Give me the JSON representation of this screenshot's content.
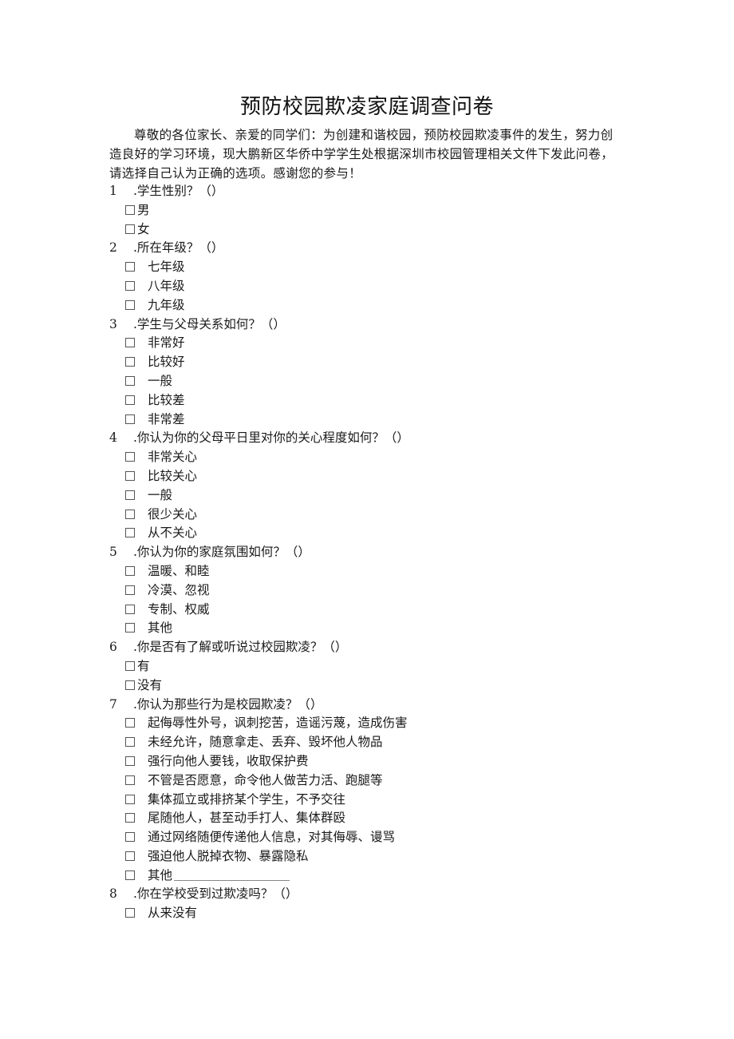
{
  "document": {
    "title": "预防校园欺凌家庭调查问卷",
    "intro": "尊敬的各位家长、亲爱的同学们：为创建和谐校园，预防校园欺凌事件的发生，努力创造良好的学习环境，现大鹏新区华侨中学学生处根据深圳市校园管理相关文件下发此问卷，请选择自己认为正确的选项。感谢您的参与！"
  },
  "questions": [
    {
      "num": "1",
      "text": ".学生性别？（）",
      "style": "tight",
      "options": [
        "男",
        "女"
      ]
    },
    {
      "num": "2",
      "text": ".所在年级？（）",
      "style": "spaced",
      "options": [
        "七年级",
        "八年级",
        "九年级"
      ]
    },
    {
      "num": "3",
      "text": ".学生与父母关系如何？（）",
      "style": "spaced",
      "options": [
        "非常好",
        "比较好",
        "一般",
        "比较差",
        "非常差"
      ]
    },
    {
      "num": "4",
      "text": ".你认为你的父母平日里对你的关心程度如何？（）",
      "style": "spaced",
      "options": [
        "非常关心",
        "比较关心",
        "一般",
        "很少关心",
        "从不关心"
      ]
    },
    {
      "num": "5",
      "text": ".你认为你的家庭氛围如何？（）",
      "style": "spaced",
      "options": [
        "温暖、和睦",
        "冷漠、忽视",
        "专制、权威",
        "其他"
      ]
    },
    {
      "num": "6",
      "text": ".你是否有了解或听说过校园欺凌？（）",
      "style": "tight",
      "options": [
        "有",
        "没有"
      ]
    },
    {
      "num": "7",
      "text": ".你认为那些行为是校园欺凌？（）",
      "style": "spaced",
      "options": [
        "起侮辱性外号，讽刺挖苦，造谣污蔑，造成伤害",
        "未经允许，随意拿走、丢弃、毁坏他人物品",
        "强行向他人要钱，收取保护费",
        "不管是否愿意，命令他人做苦力活、跑腿等",
        "集体孤立或排挤某个学生，不予交往",
        "尾随他人，甚至动手打人、集体群殴",
        "通过网络随便传递他人信息，对其侮辱、谩骂",
        "强迫他人脱掉衣物、暴露隐私",
        "其他"
      ],
      "blank_after_last": true
    },
    {
      "num": "8",
      "text": ".你在学校受到过欺凌吗？（）",
      "style": "spaced",
      "options": [
        "从来没有"
      ]
    }
  ]
}
